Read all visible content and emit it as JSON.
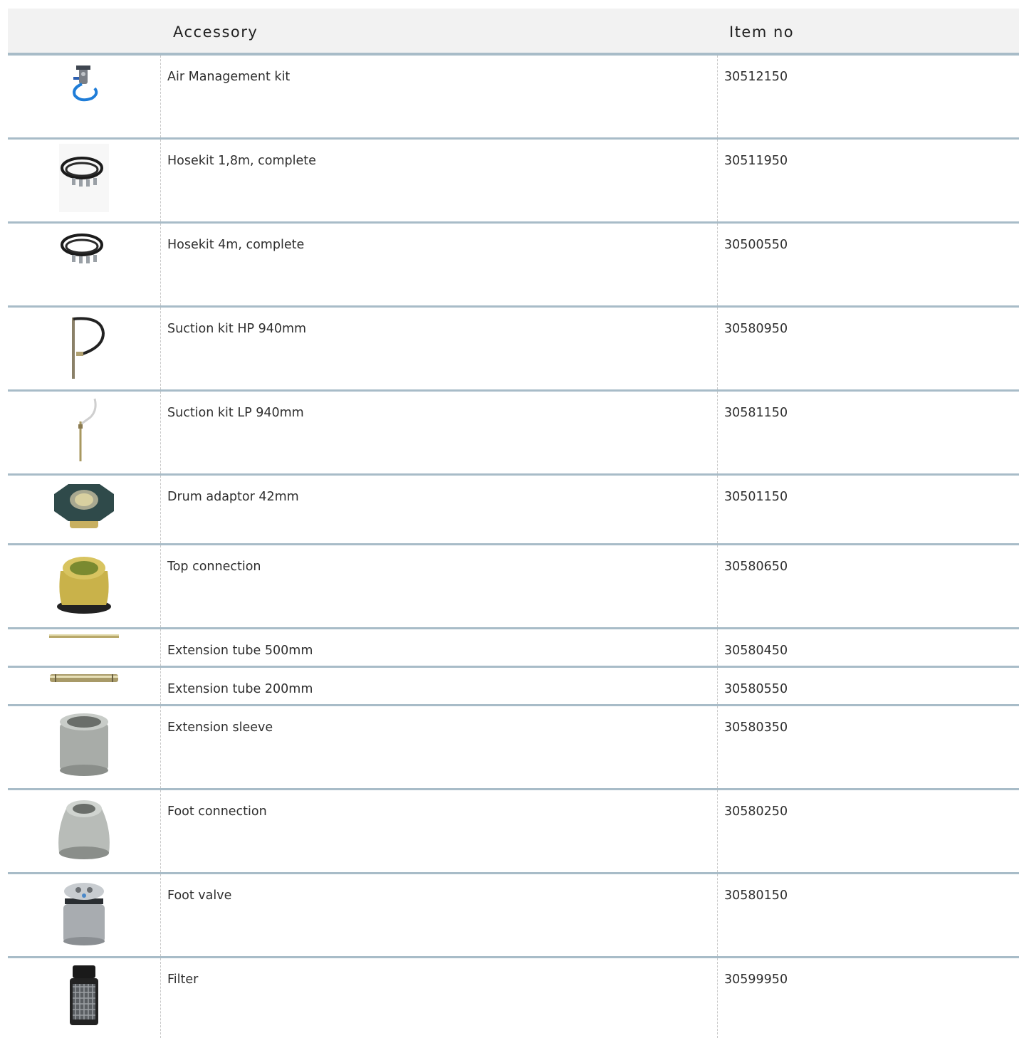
{
  "table": {
    "headers": {
      "image": "",
      "accessory": "Accessory",
      "item_no": "Item no"
    },
    "rows": [
      {
        "accessory": "Air Management kit",
        "item_no": "30512150",
        "icon": "air-management-kit-image"
      },
      {
        "accessory": "Hosekit 1,8m, complete",
        "item_no": "30511950",
        "icon": "hosekit-image"
      },
      {
        "accessory": "Hosekit 4m, complete",
        "item_no": "30500550",
        "icon": "hosekit-image"
      },
      {
        "accessory": "Suction kit HP 940mm",
        "item_no": "30580950",
        "icon": "suction-kit-hp-image"
      },
      {
        "accessory": "Suction kit LP 940mm",
        "item_no": "30581150",
        "icon": "suction-kit-lp-image"
      },
      {
        "accessory": "Drum adaptor 42mm",
        "item_no": "30501150",
        "icon": "drum-adaptor-image"
      },
      {
        "accessory": "Top connection",
        "item_no": "30580650",
        "icon": "top-connection-image"
      },
      {
        "accessory": "Extension tube 500mm",
        "item_no": "30580450",
        "icon": "extension-tube-500-image"
      },
      {
        "accessory": "Extension tube 200mm",
        "item_no": "30580550",
        "icon": "extension-tube-200-image"
      },
      {
        "accessory": "Extension sleeve",
        "item_no": "30580350",
        "icon": "extension-sleeve-image"
      },
      {
        "accessory": "Foot connection",
        "item_no": "30580250",
        "icon": "foot-connection-image"
      },
      {
        "accessory": "Foot valve",
        "item_no": "30580150",
        "icon": "foot-valve-image"
      },
      {
        "accessory": "Filter",
        "item_no": "30599950",
        "icon": "filter-image"
      }
    ]
  },
  "colors": {
    "header_bg": "#f2f2f2",
    "row_border": "#a8bcc8",
    "text": "#2e2e2e"
  }
}
